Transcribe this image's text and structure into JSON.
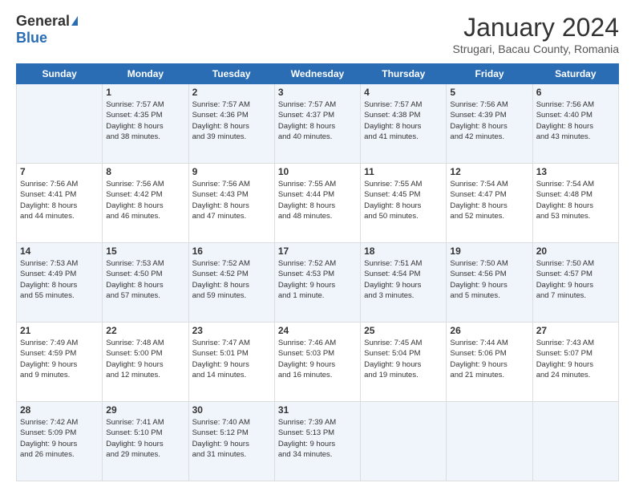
{
  "logo": {
    "general": "General",
    "blue": "Blue"
  },
  "title": "January 2024",
  "subtitle": "Strugari, Bacau County, Romania",
  "days_of_week": [
    "Sunday",
    "Monday",
    "Tuesday",
    "Wednesday",
    "Thursday",
    "Friday",
    "Saturday"
  ],
  "weeks": [
    [
      {
        "day": "",
        "info": ""
      },
      {
        "day": "1",
        "info": "Sunrise: 7:57 AM\nSunset: 4:35 PM\nDaylight: 8 hours\nand 38 minutes."
      },
      {
        "day": "2",
        "info": "Sunrise: 7:57 AM\nSunset: 4:36 PM\nDaylight: 8 hours\nand 39 minutes."
      },
      {
        "day": "3",
        "info": "Sunrise: 7:57 AM\nSunset: 4:37 PM\nDaylight: 8 hours\nand 40 minutes."
      },
      {
        "day": "4",
        "info": "Sunrise: 7:57 AM\nSunset: 4:38 PM\nDaylight: 8 hours\nand 41 minutes."
      },
      {
        "day": "5",
        "info": "Sunrise: 7:56 AM\nSunset: 4:39 PM\nDaylight: 8 hours\nand 42 minutes."
      },
      {
        "day": "6",
        "info": "Sunrise: 7:56 AM\nSunset: 4:40 PM\nDaylight: 8 hours\nand 43 minutes."
      }
    ],
    [
      {
        "day": "7",
        "info": "Sunrise: 7:56 AM\nSunset: 4:41 PM\nDaylight: 8 hours\nand 44 minutes."
      },
      {
        "day": "8",
        "info": "Sunrise: 7:56 AM\nSunset: 4:42 PM\nDaylight: 8 hours\nand 46 minutes."
      },
      {
        "day": "9",
        "info": "Sunrise: 7:56 AM\nSunset: 4:43 PM\nDaylight: 8 hours\nand 47 minutes."
      },
      {
        "day": "10",
        "info": "Sunrise: 7:55 AM\nSunset: 4:44 PM\nDaylight: 8 hours\nand 48 minutes."
      },
      {
        "day": "11",
        "info": "Sunrise: 7:55 AM\nSunset: 4:45 PM\nDaylight: 8 hours\nand 50 minutes."
      },
      {
        "day": "12",
        "info": "Sunrise: 7:54 AM\nSunset: 4:47 PM\nDaylight: 8 hours\nand 52 minutes."
      },
      {
        "day": "13",
        "info": "Sunrise: 7:54 AM\nSunset: 4:48 PM\nDaylight: 8 hours\nand 53 minutes."
      }
    ],
    [
      {
        "day": "14",
        "info": "Sunrise: 7:53 AM\nSunset: 4:49 PM\nDaylight: 8 hours\nand 55 minutes."
      },
      {
        "day": "15",
        "info": "Sunrise: 7:53 AM\nSunset: 4:50 PM\nDaylight: 8 hours\nand 57 minutes."
      },
      {
        "day": "16",
        "info": "Sunrise: 7:52 AM\nSunset: 4:52 PM\nDaylight: 8 hours\nand 59 minutes."
      },
      {
        "day": "17",
        "info": "Sunrise: 7:52 AM\nSunset: 4:53 PM\nDaylight: 9 hours\nand 1 minute."
      },
      {
        "day": "18",
        "info": "Sunrise: 7:51 AM\nSunset: 4:54 PM\nDaylight: 9 hours\nand 3 minutes."
      },
      {
        "day": "19",
        "info": "Sunrise: 7:50 AM\nSunset: 4:56 PM\nDaylight: 9 hours\nand 5 minutes."
      },
      {
        "day": "20",
        "info": "Sunrise: 7:50 AM\nSunset: 4:57 PM\nDaylight: 9 hours\nand 7 minutes."
      }
    ],
    [
      {
        "day": "21",
        "info": "Sunrise: 7:49 AM\nSunset: 4:59 PM\nDaylight: 9 hours\nand 9 minutes."
      },
      {
        "day": "22",
        "info": "Sunrise: 7:48 AM\nSunset: 5:00 PM\nDaylight: 9 hours\nand 12 minutes."
      },
      {
        "day": "23",
        "info": "Sunrise: 7:47 AM\nSunset: 5:01 PM\nDaylight: 9 hours\nand 14 minutes."
      },
      {
        "day": "24",
        "info": "Sunrise: 7:46 AM\nSunset: 5:03 PM\nDaylight: 9 hours\nand 16 minutes."
      },
      {
        "day": "25",
        "info": "Sunrise: 7:45 AM\nSunset: 5:04 PM\nDaylight: 9 hours\nand 19 minutes."
      },
      {
        "day": "26",
        "info": "Sunrise: 7:44 AM\nSunset: 5:06 PM\nDaylight: 9 hours\nand 21 minutes."
      },
      {
        "day": "27",
        "info": "Sunrise: 7:43 AM\nSunset: 5:07 PM\nDaylight: 9 hours\nand 24 minutes."
      }
    ],
    [
      {
        "day": "28",
        "info": "Sunrise: 7:42 AM\nSunset: 5:09 PM\nDaylight: 9 hours\nand 26 minutes."
      },
      {
        "day": "29",
        "info": "Sunrise: 7:41 AM\nSunset: 5:10 PM\nDaylight: 9 hours\nand 29 minutes."
      },
      {
        "day": "30",
        "info": "Sunrise: 7:40 AM\nSunset: 5:12 PM\nDaylight: 9 hours\nand 31 minutes."
      },
      {
        "day": "31",
        "info": "Sunrise: 7:39 AM\nSunset: 5:13 PM\nDaylight: 9 hours\nand 34 minutes."
      },
      {
        "day": "",
        "info": ""
      },
      {
        "day": "",
        "info": ""
      },
      {
        "day": "",
        "info": ""
      }
    ]
  ]
}
